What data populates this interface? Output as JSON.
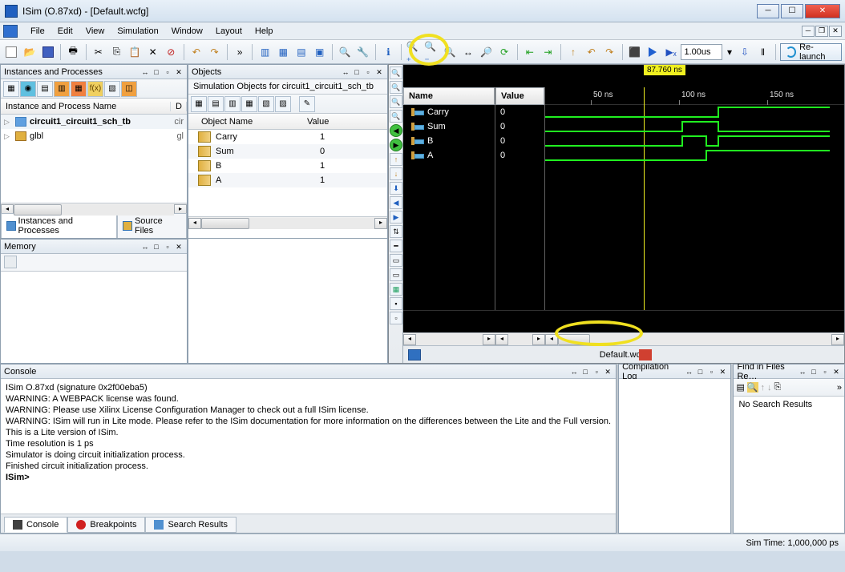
{
  "window": {
    "title": "ISim (O.87xd) - [Default.wcfg]"
  },
  "menu": [
    "File",
    "Edit",
    "View",
    "Simulation",
    "Window",
    "Layout",
    "Help"
  ],
  "toolbar": {
    "time_value": "1.00us",
    "relaunch": "Re-launch"
  },
  "panels": {
    "instances": {
      "title": "Instances and Processes",
      "col1": "Instance and Process Name",
      "col2": "D",
      "rows": [
        {
          "label": "circuit1_circuit1_sch_tb",
          "val": "cir"
        },
        {
          "label": "glbl",
          "val": "gl"
        }
      ],
      "tabs": [
        "Instances and Processes",
        "Source Files"
      ]
    },
    "objects": {
      "title": "Objects",
      "subtitle": "Simulation Objects for circuit1_circuit1_sch_tb",
      "col1": "Object Name",
      "col2": "Value",
      "rows": [
        {
          "name": "Carry",
          "val": "1"
        },
        {
          "name": "Sum",
          "val": "0"
        },
        {
          "name": "B",
          "val": "1"
        },
        {
          "name": "A",
          "val": "1"
        }
      ]
    },
    "memory": {
      "title": "Memory"
    },
    "console": {
      "title": "Console",
      "lines": [
        "ISim O.87xd (signature 0x2f00eba5)",
        "WARNING: A WEBPACK license was found.",
        "WARNING: Please use Xilinx License Configuration Manager to check out a full ISim license.",
        "WARNING: ISim will run in Lite mode. Please refer to the ISim documentation for more information on the differences between the Lite and the Full version.",
        "This is a Lite version of ISim.",
        "Time resolution is 1 ps",
        "Simulator is doing circuit initialization process.",
        "Finished circuit initialization process."
      ],
      "prompt": "ISim>",
      "tabs": [
        "Console",
        "Breakpoints",
        "Search Results"
      ]
    },
    "compilation": {
      "title": "Compilation Log"
    },
    "find": {
      "title": "Find in Files Re…",
      "no_results": "No Search Results"
    }
  },
  "waveform": {
    "name_hdr": "Name",
    "value_hdr": "Value",
    "cursor": "87.760 ns",
    "ticks": [
      "50 ns",
      "100 ns",
      "150 ns"
    ],
    "signals": [
      {
        "name": "Carry",
        "val": "0"
      },
      {
        "name": "Sum",
        "val": "0"
      },
      {
        "name": "B",
        "val": "0"
      },
      {
        "name": "A",
        "val": "0"
      }
    ],
    "file": "Default.wcfg"
  },
  "status": {
    "sim_time": "Sim Time: 1,000,000 ps"
  }
}
